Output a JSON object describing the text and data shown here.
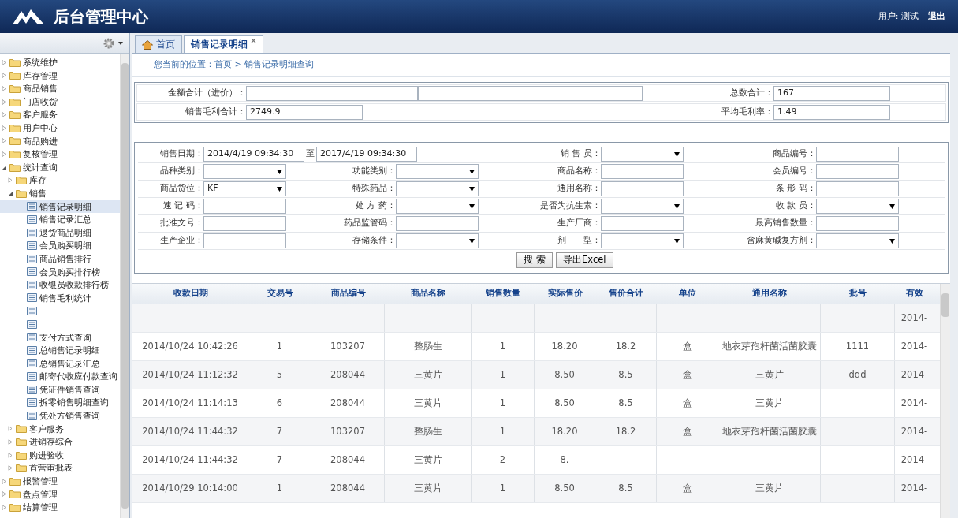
{
  "header": {
    "title": "后台管理中心",
    "user_label": "用户: 测试",
    "logout": "退出"
  },
  "sidebar": {
    "tree": [
      {
        "label": "系统维护",
        "kind": "folder",
        "expanded": false
      },
      {
        "label": "库存管理",
        "kind": "folder",
        "expanded": false
      },
      {
        "label": "商品销售",
        "kind": "folder",
        "expanded": false
      },
      {
        "label": "门店收货",
        "kind": "folder",
        "expanded": false
      },
      {
        "label": "客户服务",
        "kind": "folder",
        "expanded": false
      },
      {
        "label": "用户中心",
        "kind": "folder",
        "expanded": false
      },
      {
        "label": "商品购进",
        "kind": "folder",
        "expanded": false
      },
      {
        "label": "复核管理",
        "kind": "folder",
        "expanded": false
      },
      {
        "label": "统计查询",
        "kind": "folder",
        "expanded": true,
        "children": [
          {
            "label": "库存",
            "kind": "folder",
            "expanded": false
          },
          {
            "label": "销售",
            "kind": "folder",
            "expanded": true,
            "children": [
              {
                "label": "销售记录明细",
                "kind": "page",
                "selected": true
              },
              {
                "label": "销售记录汇总",
                "kind": "page",
                "selected": false
              },
              {
                "label": "退货商品明细",
                "kind": "page",
                "selected": false
              },
              {
                "label": "会员购买明细",
                "kind": "page",
                "selected": false
              },
              {
                "label": "商品销售排行",
                "kind": "page",
                "selected": false
              },
              {
                "label": "会员购买排行榜",
                "kind": "page",
                "selected": false
              },
              {
                "label": "收银员收款排行榜",
                "kind": "page",
                "selected": false
              },
              {
                "label": "销售毛利统计",
                "kind": "page",
                "selected": false
              },
              {
                "kind": "page",
                "selected": false
              },
              {
                "kind": "page",
                "selected": false
              },
              {
                "label": "支付方式查询",
                "kind": "page",
                "selected": false
              },
              {
                "label": "总销售记录明细",
                "kind": "page",
                "selected": false
              },
              {
                "label": "总销售记录汇总",
                "kind": "page",
                "selected": false
              },
              {
                "label": "邮寄代收应付款查询",
                "kind": "page",
                "selected": false
              },
              {
                "label": "凭证件销售查询",
                "kind": "page",
                "selected": false
              },
              {
                "label": "拆零销售明细查询",
                "kind": "page",
                "selected": false
              },
              {
                "label": "凭处方销售查询",
                "kind": "page",
                "selected": false
              }
            ]
          },
          {
            "label": "客户服务",
            "kind": "folder",
            "expanded": false
          },
          {
            "label": "进销存综合",
            "kind": "folder",
            "expanded": false
          },
          {
            "label": "购进验收",
            "kind": "folder",
            "expanded": false
          },
          {
            "label": "首营审批表",
            "kind": "folder",
            "expanded": false
          }
        ]
      },
      {
        "label": "报警管理",
        "kind": "folder",
        "expanded": false
      },
      {
        "label": "盘点管理",
        "kind": "folder",
        "expanded": false
      },
      {
        "label": "结算管理",
        "kind": "folder",
        "expanded": false
      }
    ]
  },
  "tabs": [
    {
      "label": "首页",
      "kind": "home",
      "selected": false,
      "closable": false
    },
    {
      "label": "销售记录明细",
      "kind": "page",
      "selected": true,
      "closable": true
    }
  ],
  "breadcrumb": "您当前的位置：首页 > 销售记录明细查询",
  "summary": {
    "left": [
      {
        "label": "金额合计（进价）："
      },
      {
        "label": "销售毛利合计：",
        "value": "2749.9"
      }
    ],
    "right": [
      {
        "label": "总数合计：",
        "value": "167"
      },
      {
        "label": "平均毛利率：",
        "value": "1.49"
      }
    ]
  },
  "filters": [
    [
      {
        "label": "销售日期：",
        "kind": "date_range",
        "from": "2014/4/19 09:34:30",
        "sep": "至",
        "to": "2017/4/19 09:34:30"
      },
      {
        "label": "销 售 员：",
        "kind": "select"
      },
      {
        "label": "商品编号：",
        "kind": "input"
      }
    ],
    [
      {
        "label": "品种类别：",
        "kind": "select"
      },
      {
        "label": "功能类别：",
        "kind": "select"
      },
      {
        "label": "商品名称：",
        "kind": "input"
      },
      {
        "label": "会员编号：",
        "kind": "input"
      }
    ],
    [
      {
        "label": "商品货位：",
        "kind": "select",
        "value": "KF"
      },
      {
        "label": "特殊药品：",
        "kind": "select"
      },
      {
        "label": "通用名称：",
        "kind": "input"
      },
      {
        "label": "条 形 码：",
        "kind": "input"
      }
    ],
    [
      {
        "label": "速 记 码：",
        "kind": "input"
      },
      {
        "label": "处 方 药：",
        "kind": "select"
      },
      {
        "label": "是否为抗生素：",
        "kind": "select"
      },
      {
        "label": "收 款 员：",
        "kind": "select"
      }
    ],
    [
      {
        "label": "批准文号：",
        "kind": "input"
      },
      {
        "label": "药品监管码：",
        "kind": "input"
      },
      {
        "label": "生产厂商：",
        "kind": "input"
      },
      {
        "label": "最高销售数量：",
        "kind": "input"
      }
    ],
    [
      {
        "label": "生产企业：",
        "kind": "input"
      },
      {
        "label": "存储条件：",
        "kind": "select"
      },
      {
        "label": "剂　　型：",
        "kind": "select"
      },
      {
        "label": "含麻黄碱复方剂：",
        "kind": "select"
      }
    ]
  ],
  "buttons": [
    "搜 索",
    "导出Excel"
  ],
  "table": {
    "columns": [
      "收款日期",
      "交易号",
      "商品编号",
      "商品名称",
      "销售数量",
      "实际售价",
      "售价合计",
      "单位",
      "通用名称",
      "批号",
      "有效"
    ],
    "rows": [
      [
        null,
        null,
        null,
        null,
        null,
        null,
        null,
        null,
        null,
        null,
        "2014-"
      ],
      [
        "2014/10/24 10:42:26",
        "1",
        "103207",
        "整肠生",
        "1",
        "18.20",
        "18.2",
        "盒",
        "地衣芽孢杆菌活菌胶囊",
        "1111",
        "2014-"
      ],
      [
        "2014/10/24 11:12:32",
        "5",
        "208044",
        "三黄片",
        "1",
        "8.50",
        "8.5",
        "盒",
        "三黄片",
        "ddd",
        "2014-"
      ],
      [
        "2014/10/24 11:14:13",
        "6",
        "208044",
        "三黄片",
        "1",
        "8.50",
        "8.5",
        "盒",
        "三黄片",
        null,
        "2014-"
      ],
      [
        "2014/10/24 11:44:32",
        "7",
        "103207",
        "整肠生",
        "1",
        "18.20",
        "18.2",
        "盒",
        "地衣芽孢杆菌活菌胶囊",
        null,
        "2014-"
      ],
      [
        "2014/10/24 11:44:32",
        "7",
        "208044",
        "三黄片",
        "2",
        "8.",
        null,
        null,
        null,
        null,
        "2014-"
      ],
      [
        "2014/10/29 10:14:00",
        "1",
        "208044",
        "三黄片",
        "1",
        "8.50",
        "8.5",
        "盒",
        "三黄片",
        null,
        "2014-"
      ]
    ]
  }
}
